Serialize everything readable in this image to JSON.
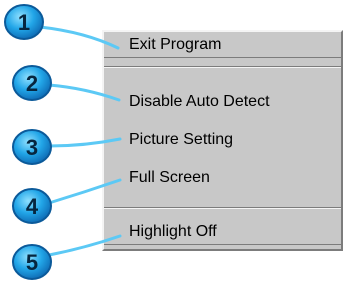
{
  "menu": {
    "items": [
      {
        "label": "Exit Program"
      },
      {
        "label": "Disable Auto Detect"
      },
      {
        "label": "Picture Setting"
      },
      {
        "label": "Full Screen"
      },
      {
        "label": "Highlight Off"
      }
    ]
  },
  "callouts": [
    {
      "number": "1"
    },
    {
      "number": "2"
    },
    {
      "number": "3"
    },
    {
      "number": "4"
    },
    {
      "number": "5"
    }
  ],
  "colors": {
    "callout_fill": "#22a6e8",
    "callout_outline": "#0b5a9a",
    "leader_line": "#5cc9f5",
    "menu_bg": "#c8c8c8"
  }
}
